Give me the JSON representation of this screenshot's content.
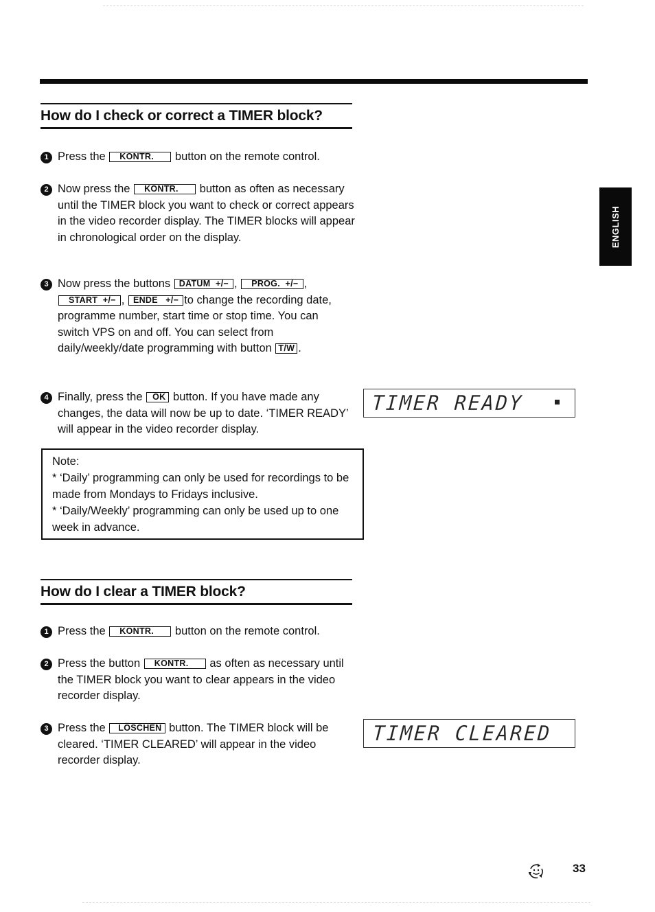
{
  "language_tab": "ENGLISH",
  "page_number": "33",
  "icons": {
    "footer": "recycle-smiley-icon"
  },
  "section1": {
    "title": "How do I check or correct a TIMER block?",
    "steps": [
      {
        "num": "1",
        "pre": "Press the",
        "key": "KONTR.",
        "post": "button on the remote control."
      },
      {
        "num": "2",
        "pre": "Now press the",
        "key": "KONTR.",
        "post": "button as often as necessary until the TIMER block you want to check or correct appears in the video recorder display. The TIMER blocks will appear in chronological order on the display."
      },
      {
        "num": "3",
        "pre": "Now press the buttons",
        "keys": [
          "DATUM  +/−",
          "PROG.  +/−",
          "START  +/−",
          "ENDE   +/−",
          "T/W"
        ],
        "sep1": ",",
        "sep2": ",",
        "sep3": ",",
        "mid": "to change the recording date, programme number, start time or stop time. You can switch VPS on and off. You can select from daily/weekly/date programming with button",
        "post": "."
      },
      {
        "num": "4",
        "pre": "Finally, press the",
        "key": "OK",
        "post": "button. If you have made any changes, the data will now be up to date. ‘TIMER READY’ will appear in the video recorder display."
      }
    ],
    "display": {
      "text": "TIMER READY",
      "indicator": "■"
    }
  },
  "note": {
    "heading": "Note:",
    "items": [
      "* ‘Daily’ programming can only be used for recordings to be made from Mondays to Fridays inclusive.",
      "* ‘Daily/Weekly’ programming can only be used up to one week in advance."
    ]
  },
  "section2": {
    "title": "How do I clear a TIMER block?",
    "steps": [
      {
        "num": "1",
        "pre": "Press the",
        "key": "KONTR.",
        "post": "button on the remote control."
      },
      {
        "num": "2",
        "pre": "Press the button",
        "key": "KONTR.",
        "post": "as often as necessary until the TIMER block you want to clear appears in the video recorder display."
      },
      {
        "num": "3",
        "pre": "Press the",
        "key": "LÖSCHEN",
        "post": "button. The TIMER block will be cleared. ‘TIMER CLEARED’ will appear in the video recorder display."
      }
    ],
    "display": {
      "text": "TIMER CLEARED"
    }
  }
}
